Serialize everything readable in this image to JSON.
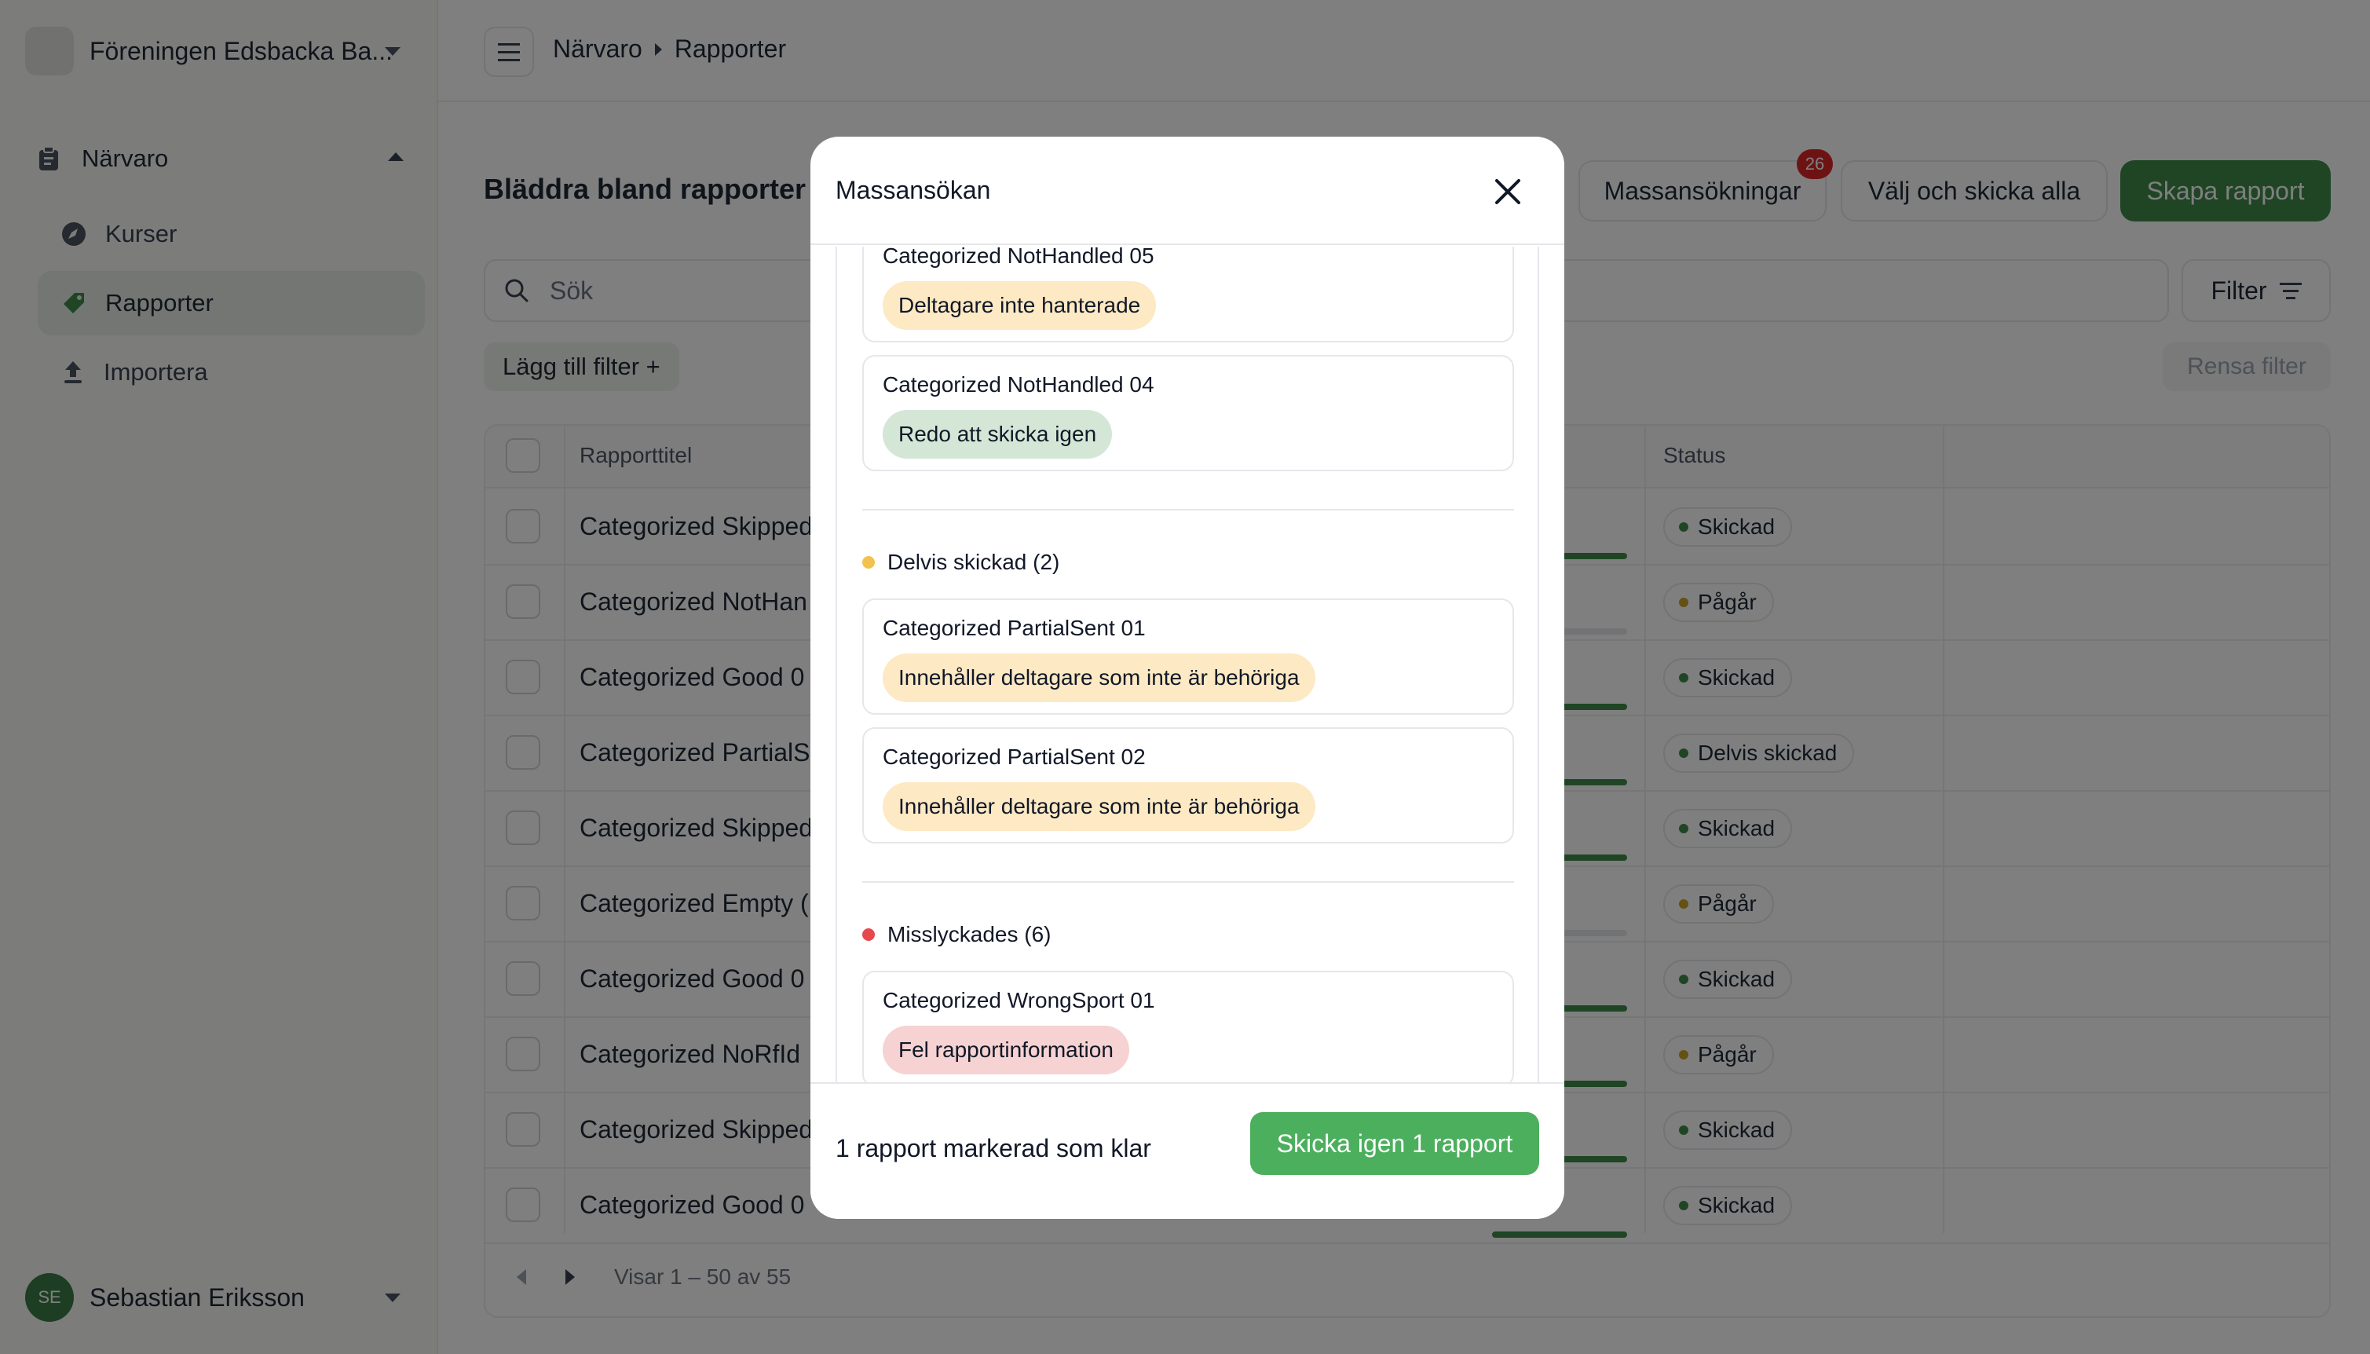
{
  "sidebar": {
    "org_name": "Föreningen Edsbacka Ba...",
    "group_label": "Närvaro",
    "items": [
      {
        "label": "Kurser"
      },
      {
        "label": "Rapporter"
      },
      {
        "label": "Importera"
      }
    ],
    "user": {
      "initials": "SE",
      "name": "Sebastian Eriksson"
    }
  },
  "topbar": {
    "breadcrumb": [
      "Närvaro",
      "Rapporter"
    ]
  },
  "main": {
    "title": "Bläddra bland rapporter",
    "buttons": {
      "massansokningar": "Massansökningar",
      "massansokningar_badge": "26",
      "select_send_all": "Välj och skicka alla",
      "create_report": "Skapa rapport"
    },
    "search_placeholder": "Sök",
    "filter_label": "Filter",
    "add_filter_label": "Lägg till filter +",
    "clear_filter_label": "Rensa filter",
    "table": {
      "columns": [
        "Rapporttitel",
        "Status"
      ],
      "rows": [
        {
          "title": "Categorized Skipped",
          "progress": 1.0,
          "status": "Skickad",
          "status_color": "#3f8a4a"
        },
        {
          "title": "Categorized NotHan",
          "progress": 0.0,
          "status": "Pågår",
          "status_color": "#c9a227"
        },
        {
          "title": "Categorized Good 0",
          "progress": 1.0,
          "status": "Skickad",
          "status_color": "#3f8a4a"
        },
        {
          "title": "Categorized PartialS",
          "progress": 1.0,
          "status": "Delvis skickad",
          "status_color": "#3f8a4a"
        },
        {
          "title": "Categorized Skipped",
          "progress": 1.0,
          "status": "Skickad",
          "status_color": "#3f8a4a"
        },
        {
          "title": "Categorized Empty (",
          "progress": 0.0,
          "status": "Pågår",
          "status_color": "#c9a227"
        },
        {
          "title": "Categorized Good 0",
          "progress": 1.0,
          "status": "Skickad",
          "status_color": "#3f8a4a"
        },
        {
          "title": "Categorized NoRfId",
          "progress": 1.0,
          "status": "Pågår",
          "status_color": "#c9a227"
        },
        {
          "title": "Categorized Skipped",
          "progress": 1.0,
          "status": "Skickad",
          "status_color": "#3f8a4a"
        },
        {
          "title": "Categorized Good 0",
          "progress": 1.0,
          "status": "Skickad",
          "status_color": "#3f8a4a"
        }
      ],
      "pagination": "Visar 1 – 50 av 55"
    }
  },
  "modal": {
    "title": "Massansökan",
    "items": [
      {
        "title": "Categorized NotHandled 05",
        "tag": "Deltagare inte hanterade",
        "tag_color": "#fde9c3"
      },
      {
        "title": "Categorized NotHandled 04",
        "tag": "Redo att skicka igen",
        "tag_color": "#d4e7d6"
      }
    ],
    "groups": [
      {
        "label": "Delvis skickad (2)",
        "color": "#f2c14e",
        "items": [
          {
            "title": "Categorized PartialSent 01",
            "tag": "Innehåller deltagare som inte är behöriga",
            "tag_color": "#fde9c3"
          },
          {
            "title": "Categorized PartialSent 02",
            "tag": "Innehåller deltagare som inte är behöriga",
            "tag_color": "#fde9c3"
          }
        ]
      },
      {
        "label": "Misslyckades (6)",
        "color": "#e5484d",
        "items": [
          {
            "title": "Categorized WrongSport 01",
            "tag": "Fel rapportinformation",
            "tag_color": "#f6d2d2"
          }
        ]
      }
    ],
    "footer_text": "1 rapport markerad som klar",
    "primary_button": "Skicka igen 1 rapport"
  },
  "colors": {
    "accent": "#3f8a4a",
    "modal_button": "#4caf5e",
    "badge": "#dc2626"
  },
  "icons": [
    "caret-down-icon",
    "clipboard-icon",
    "compass-icon",
    "tag-icon",
    "upload-icon",
    "menu-icon",
    "search-icon",
    "filter-icon",
    "close-icon",
    "chevron-left-icon",
    "chevron-right-icon"
  ]
}
